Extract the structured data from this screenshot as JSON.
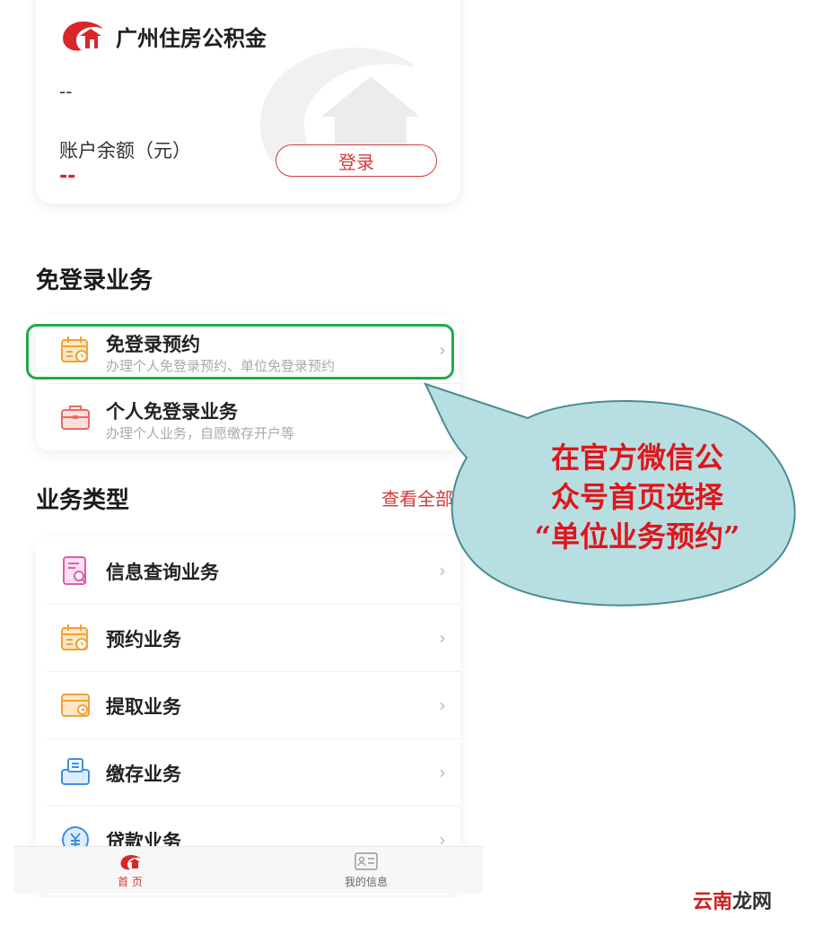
{
  "account": {
    "brand_title": "广州住房公积金",
    "account_id": "--",
    "balance_label": "账户余额（元）",
    "balance_value": "--",
    "login_button": "登录"
  },
  "free_login": {
    "heading": "免登录业务",
    "items": [
      {
        "title": "免登录预约",
        "subtitle": "办理个人免登录预约、单位免登录预约",
        "icon": "calendar-clock-icon"
      },
      {
        "title": "个人免登录业务",
        "subtitle": "办理个人业务，自愿缴存开户等",
        "icon": "briefcase-icon"
      }
    ]
  },
  "business_types": {
    "heading": "业务类型",
    "view_all": "查看全部",
    "items": [
      {
        "title": "信息查询业务",
        "icon": "document-search-icon"
      },
      {
        "title": "预约业务",
        "icon": "calendar-clock-icon"
      },
      {
        "title": "提取业务",
        "icon": "wallet-icon"
      },
      {
        "title": "缴存业务",
        "icon": "inbox-icon"
      },
      {
        "title": "贷款业务",
        "icon": "yuan-coin-icon"
      }
    ]
  },
  "tabbar": {
    "home_label": "首 页",
    "my_info_label": "我的信息"
  },
  "callout": {
    "lines": [
      "在官方微信公",
      "众号首页选择",
      "“单位业务预约”"
    ]
  },
  "site_watermark": {
    "part1": "云南",
    "part2": "龙网"
  },
  "colors": {
    "brand_red": "#d43a3a",
    "highlight_green": "#22a84a",
    "callout_fill": "#b7dfe2",
    "callout_text": "#e0151b"
  }
}
